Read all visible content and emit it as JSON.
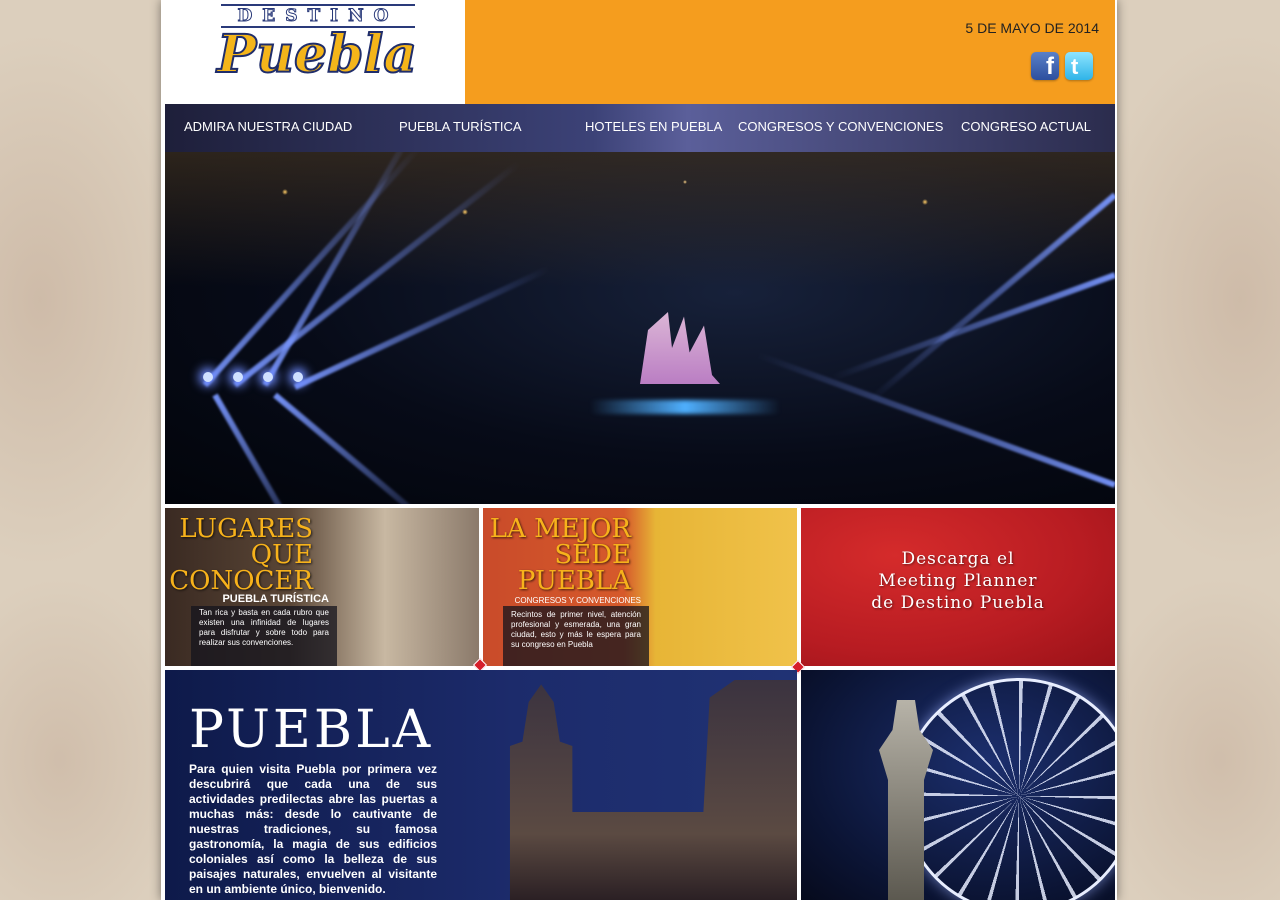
{
  "header": {
    "logo_top": "DESTINO",
    "logo_main": "Puebla",
    "date": "5 DE MAYO DE 2014",
    "social": {
      "facebook_glyph": "f",
      "twitter_glyph": "t"
    }
  },
  "nav": {
    "items": [
      {
        "label": "ADMIRA NUESTRA CIUDAD"
      },
      {
        "label": "PUEBLA TURÍSTICA"
      },
      {
        "label": "HOTELES EN PUEBLA"
      },
      {
        "label": "CONGRESOS Y CONVENCIONES"
      },
      {
        "label": "CONGRESO ACTUAL"
      }
    ]
  },
  "promos": [
    {
      "title": "LUGARES\nQUE\nCONOCER",
      "subtitle": "PUEBLA TURÍSTICA",
      "text": "Tan rica y basta en cada rubro que existen una infinidad de lugares para disfrutar y sobre todo para realizar sus convenciones."
    },
    {
      "title": "LA MEJOR\nSEDE\nPUEBLA",
      "subtitle": "CONGRESOS Y CONVENCIONES",
      "text": "Recintos de primer nivel, atención profesional y esmerada, una gran ciudad, esto y más le espera para su congreso en Puebla"
    },
    {
      "title": "Descarga el\nMeeting Planner\nde Destino Puebla"
    }
  ],
  "feature": {
    "title": "PUEBLA",
    "text": "Para quien visita Puebla por primera vez descubrirá que cada una de sus actividades predilectas abre las puertas a muchas más: desde lo cautivante de nuestras tradiciones, su famosa gastronomía, la magia de sus edificios coloniales así como la belleza de sus paisajes naturales, envuelven al visitante en un ambiente único, bienvenido."
  },
  "colors": {
    "orange": "#f59d1e",
    "navy": "#1c2b6b",
    "gold": "#f7b21b",
    "red": "#b81c22"
  }
}
